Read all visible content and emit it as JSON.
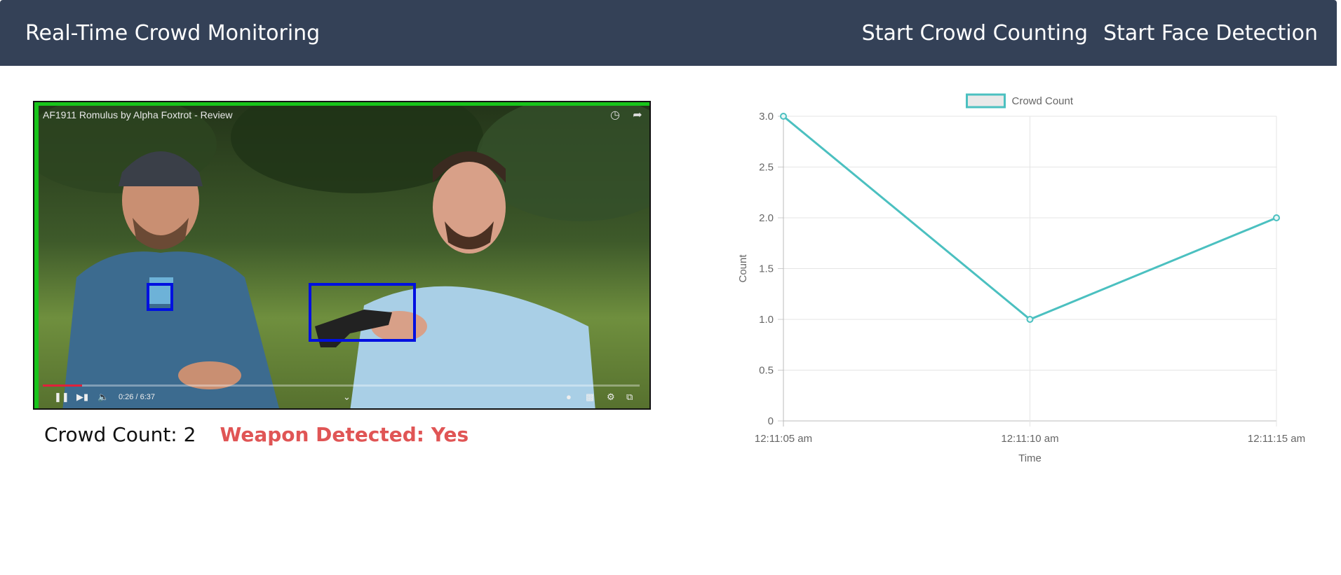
{
  "navbar": {
    "brand": "Real-Time Crowd Monitoring",
    "links": [
      "Start Crowd Counting",
      "Start Face Detection"
    ]
  },
  "video": {
    "title": "AF1911 Romulus by Alpha Foxtrot - Review",
    "time": "0:26 / 6:37",
    "progress_fraction": 0.066
  },
  "status": {
    "crowd_count_label": "Crowd Count: 2",
    "weapon_label": "Weapon Detected: Yes"
  },
  "colors": {
    "navbar": "#344157",
    "line": "#4bc0c0",
    "weapon_alert": "#e05555",
    "detection_box": "#0010e0"
  },
  "chart_data": {
    "type": "line",
    "x": [
      "12:11:05 am",
      "12:11:10 am",
      "12:11:15 am"
    ],
    "series": [
      {
        "name": "Crowd Count",
        "values": [
          3,
          1,
          2
        ]
      }
    ],
    "xlabel": "Time",
    "ylabel": "Count",
    "ylim": [
      0,
      3
    ],
    "yticks": [
      "0",
      "0.5",
      "1.0",
      "1.5",
      "2.0",
      "2.5",
      "3.0"
    ],
    "grid": true,
    "legend": "top"
  }
}
